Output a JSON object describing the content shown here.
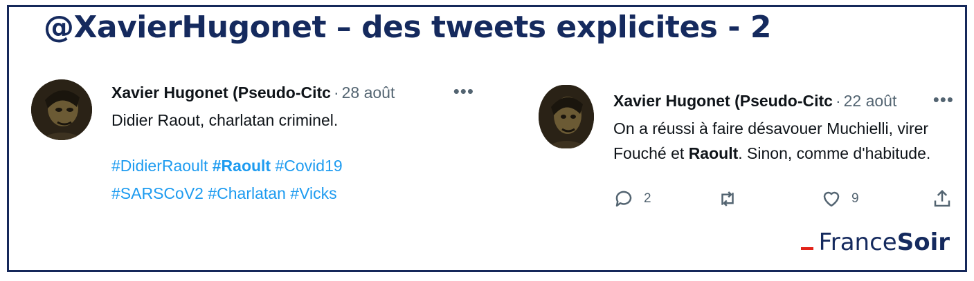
{
  "headline": "@XavierHugonet – des tweets explicites - 2",
  "tweets": [
    {
      "author": "Xavier Hugonet (Pseudo-Citc",
      "separator": "·",
      "date": "28 août",
      "more": "•••",
      "text": "Didier Raout, charlatan criminel.",
      "hashtags": [
        "#DidierRaoult",
        "#Raoult",
        "#Covid19",
        "#SARSCoV2",
        "#Charlatan",
        "#Vicks"
      ]
    },
    {
      "author": "Xavier Hugonet (Pseudo-Citc",
      "separator": "·",
      "date": "22 août",
      "more": "•••",
      "text_line1": "On a réussi à faire désavouer Muchielli, virer",
      "text_line2_pre": "Fouché et ",
      "text_line2_bold": "Raoult",
      "text_line2_post": ". Sinon, comme d'habitude.",
      "actions": {
        "reply_icon": "reply-icon",
        "reply_count": "2",
        "retweet_icon": "retweet-icon",
        "like_icon": "heart-icon",
        "like_count": "9",
        "share_icon": "share-icon"
      }
    }
  ],
  "brand": {
    "regular": "France",
    "bold": "Soir",
    "accent_color": "#e2231a"
  },
  "colors": {
    "navy": "#152a5e",
    "link": "#1d9bf0",
    "muted": "#536471"
  }
}
